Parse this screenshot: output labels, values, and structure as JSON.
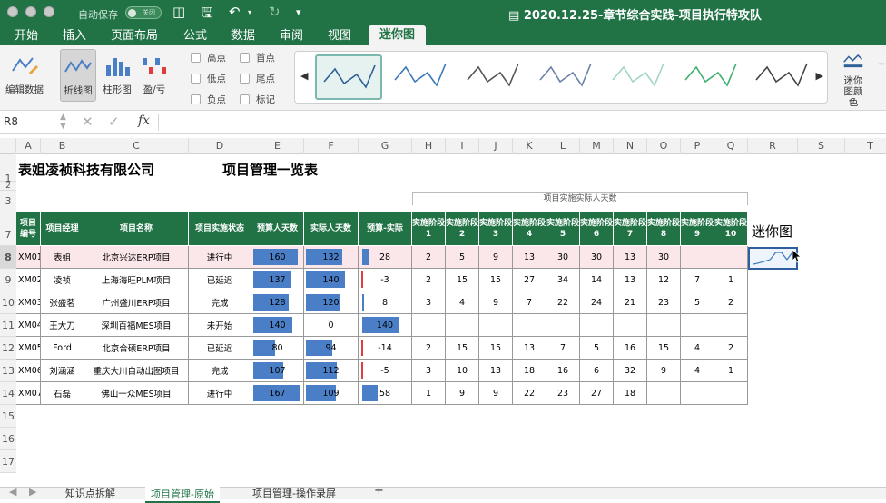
{
  "window": {
    "autosave_label": "自动保存",
    "autosave_state": "关闭",
    "title": "2020.12.25-章节综合实践-项目执行特攻队"
  },
  "tabs": [
    "开始",
    "插入",
    "页面布局",
    "公式",
    "数据",
    "审阅",
    "视图",
    "迷你图"
  ],
  "active_tab": "迷你图",
  "ribbon": {
    "edit_data": "编辑数据",
    "line": "折线图",
    "column": "柱形图",
    "winloss": "盈/亏",
    "checks": [
      "高点",
      "首点",
      "低点",
      "尾点",
      "负点",
      "标记"
    ],
    "spark_color": "迷你图颜色",
    "gallery_colors": [
      "#2f5f99",
      "#3a78b8",
      "#555555",
      "#6a82a8",
      "#9fd6c2",
      "#3fae6f",
      "#444444"
    ]
  },
  "formula_bar": {
    "namebox": "R8",
    "fx": "fx",
    "value": ""
  },
  "columns": [
    "A",
    "B",
    "C",
    "D",
    "E",
    "F",
    "G",
    "H",
    "I",
    "J",
    "K",
    "L",
    "M",
    "N",
    "O",
    "P",
    "Q",
    "R",
    "S",
    "T"
  ],
  "rows": [
    "1",
    "2",
    "3",
    "7",
    "8",
    "9",
    "10",
    "11",
    "12",
    "13",
    "14",
    "15",
    "16",
    "17"
  ],
  "sheet": {
    "company": "表姐凌祯科技有限公司",
    "title": "项目管理一览表",
    "actual_group_header": "项目实施实际人天数",
    "sparkline_label": "迷你图",
    "headers": [
      "项目编号",
      "项目经理",
      "项目名称",
      "项目实施状态",
      "预算人天数",
      "实际人天数",
      "预算-实际",
      "实施阶段1",
      "实施阶段2",
      "实施阶段3",
      "实施阶段4",
      "实施阶段5",
      "实施阶段6",
      "实施阶段7",
      "实施阶段8",
      "实施阶段9",
      "实施阶段10"
    ],
    "data": [
      {
        "id": "XM01",
        "mgr": "表姐",
        "name": "北京兴达ERP项目",
        "status": "进行中",
        "budget": 160,
        "actual": 132,
        "diff": 28,
        "stages": [
          "2",
          "5",
          "9",
          "13",
          "30",
          "30",
          "13",
          "30",
          "",
          ""
        ]
      },
      {
        "id": "XM02",
        "mgr": "凌祯",
        "name": "上海海旺PLM项目",
        "status": "已延迟",
        "budget": 137,
        "actual": 140,
        "diff": -3,
        "stages": [
          "2",
          "15",
          "15",
          "27",
          "34",
          "14",
          "13",
          "12",
          "7",
          "1"
        ]
      },
      {
        "id": "XM03",
        "mgr": "张盛茗",
        "name": "广州盛川ERP项目",
        "status": "完成",
        "budget": 128,
        "actual": 120,
        "diff": 8,
        "stages": [
          "3",
          "4",
          "9",
          "7",
          "22",
          "24",
          "21",
          "23",
          "5",
          "2"
        ]
      },
      {
        "id": "XM04",
        "mgr": "王大刀",
        "name": "深圳百福MES项目",
        "status": "未开始",
        "budget": 140,
        "actual": 0,
        "diff": 140,
        "stages": [
          "",
          "",
          "",
          "",
          "",
          "",
          "",
          "",
          "",
          ""
        ]
      },
      {
        "id": "XM05",
        "mgr": "Ford",
        "name": "北京合硕ERP项目",
        "status": "已延迟",
        "budget": 80,
        "actual": 94,
        "diff": -14,
        "stages": [
          "2",
          "15",
          "15",
          "13",
          "7",
          "5",
          "16",
          "15",
          "4",
          "2"
        ]
      },
      {
        "id": "XM06",
        "mgr": "刘涵涵",
        "name": "重庆大川自动出图项目",
        "status": "完成",
        "budget": 107,
        "actual": 112,
        "diff": -5,
        "stages": [
          "3",
          "10",
          "13",
          "18",
          "16",
          "6",
          "32",
          "9",
          "4",
          "1"
        ]
      },
      {
        "id": "XM07",
        "mgr": "石磊",
        "name": "佛山一众MES项目",
        "status": "进行中",
        "budget": 167,
        "actual": 109,
        "diff": 58,
        "stages": [
          "1",
          "9",
          "9",
          "22",
          "23",
          "27",
          "18",
          "",
          "",
          ""
        ]
      }
    ]
  },
  "sheet_tabs": [
    "知识点拆解",
    "项目管理-原始",
    "项目管理-操作录屏"
  ],
  "active_sheet": "项目管理-原始"
}
